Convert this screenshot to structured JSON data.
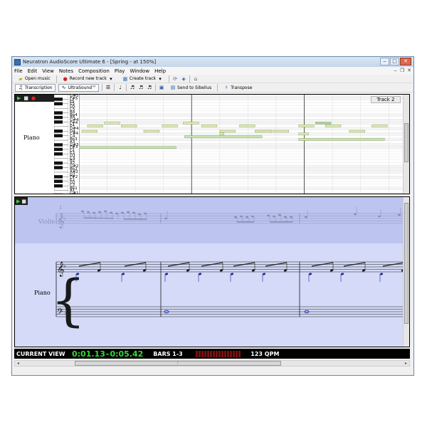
{
  "window": {
    "title": "Neuratron AudioScore Ultimate 6 - [Spring - at 150%]",
    "controls": {
      "minimize": "‒",
      "maximize": "□",
      "close": "✕"
    },
    "mdi_controls": {
      "minimize": "‒",
      "restore": "❐",
      "close": "✕"
    }
  },
  "menu": [
    "File",
    "Edit",
    "View",
    "Notes",
    "Composition",
    "Play",
    "Window",
    "Help"
  ],
  "toolbar1": {
    "open_music": "Open music",
    "record_new_track": "Record new track",
    "create_track": "Create track"
  },
  "toolbar2": {
    "transcription": "Transcription",
    "ultrasound": "UltraSound™",
    "send_to_sibelius": "Send to Sibelius",
    "transpose": "Transpose"
  },
  "piano_roll": {
    "instrument": "Piano",
    "track_label": "Track 2",
    "note_names": [
      "G#5",
      "F#5",
      "F5",
      "E5",
      "D5",
      "C5",
      "B4",
      "Bb4",
      "A4",
      "G#4",
      "F#4",
      "E4",
      "D#4",
      "D4",
      "C#4",
      "C4",
      "Bb3",
      "A3",
      "G#3",
      "F#3",
      "F3",
      "E3",
      "D3",
      "C3",
      "B2",
      "A2",
      "G#2",
      "Bb2",
      "A#2",
      "G2",
      "F#2",
      "E2",
      "D2",
      "C2",
      "Bb1",
      "A1",
      "G#1"
    ],
    "notes": [
      {
        "pitch": "F#4",
        "start": 0.9,
        "length": 0.55,
        "color": "#e3efb6"
      },
      {
        "pitch": "E4",
        "start": 0.3,
        "length": 0.55,
        "color": "#e3efb6"
      },
      {
        "pitch": "D4",
        "start": 0.1,
        "length": 0.55,
        "color": "#e3efb6"
      },
      {
        "pitch": "E4",
        "start": 1.5,
        "length": 0.55,
        "color": "#e3efb6"
      },
      {
        "pitch": "D4",
        "start": 2.3,
        "length": 0.55,
        "color": "#e3efb6"
      },
      {
        "pitch": "E4",
        "start": 2.95,
        "length": 0.55,
        "color": "#e3efb6"
      },
      {
        "pitch": "F#4",
        "start": 3.7,
        "length": 0.55,
        "color": "#e3efb6"
      },
      {
        "pitch": "E4",
        "start": 4.35,
        "length": 0.55,
        "color": "#e3efb6"
      },
      {
        "pitch": "D4",
        "start": 5.0,
        "length": 0.55,
        "color": "#e3efb6"
      },
      {
        "pitch": "E4",
        "start": 5.7,
        "length": 0.55,
        "color": "#e3efb6"
      },
      {
        "pitch": "D4",
        "start": 6.3,
        "length": 0.55,
        "color": "#e3efb6"
      },
      {
        "pitch": "D4",
        "start": 6.9,
        "length": 0.55,
        "color": "#e3efb6"
      },
      {
        "pitch": "E4",
        "start": 7.8,
        "length": 0.55,
        "color": "#e3efb6"
      },
      {
        "pitch": "F#4",
        "start": 8.4,
        "length": 0.55,
        "color": "#a6d49a"
      },
      {
        "pitch": "E4",
        "start": 8.75,
        "length": 0.55,
        "color": "#e3efb6"
      },
      {
        "pitch": "D4",
        "start": 9.6,
        "length": 0.55,
        "color": "#e3efb6"
      },
      {
        "pitch": "E4",
        "start": 10.4,
        "length": 0.55,
        "color": "#e3efb6"
      },
      {
        "pitch": "D4",
        "start": 6.25,
        "length": 0.6,
        "color": "#e3efb6"
      },
      {
        "pitch": "C#4",
        "start": 7.8,
        "length": 0.35,
        "color": "#e3efb6"
      },
      {
        "pitch": "C#4",
        "start": 5.0,
        "length": 0.15,
        "color": "#e3efb6"
      },
      {
        "pitch": "C4",
        "start": 3.75,
        "length": 2.75,
        "color": "#c6e6b0"
      },
      {
        "pitch": "Bb3",
        "start": 7.8,
        "length": 3.05,
        "color": "#c6e6b0"
      },
      {
        "pitch": "F#3",
        "start": 0.0,
        "length": 3.45,
        "color": "#c6e6b0"
      }
    ]
  },
  "score": {
    "bar_number": "1",
    "violin_label": "Violin",
    "piano_label": "Piano"
  },
  "status": {
    "current_view": "CURRENT VIEW",
    "time_start": "0:01.13",
    "time_separator": "-",
    "time_end": "0:05.42",
    "bars": "BARS 1-3",
    "tempo": "123 QPM"
  },
  "colors": {
    "roll_note": "#e3efb6",
    "roll_note_long": "#c6e6b0",
    "score_bg": "#d4daf7",
    "violin_band": "#bcc4ef",
    "time_green": "#37d837"
  }
}
